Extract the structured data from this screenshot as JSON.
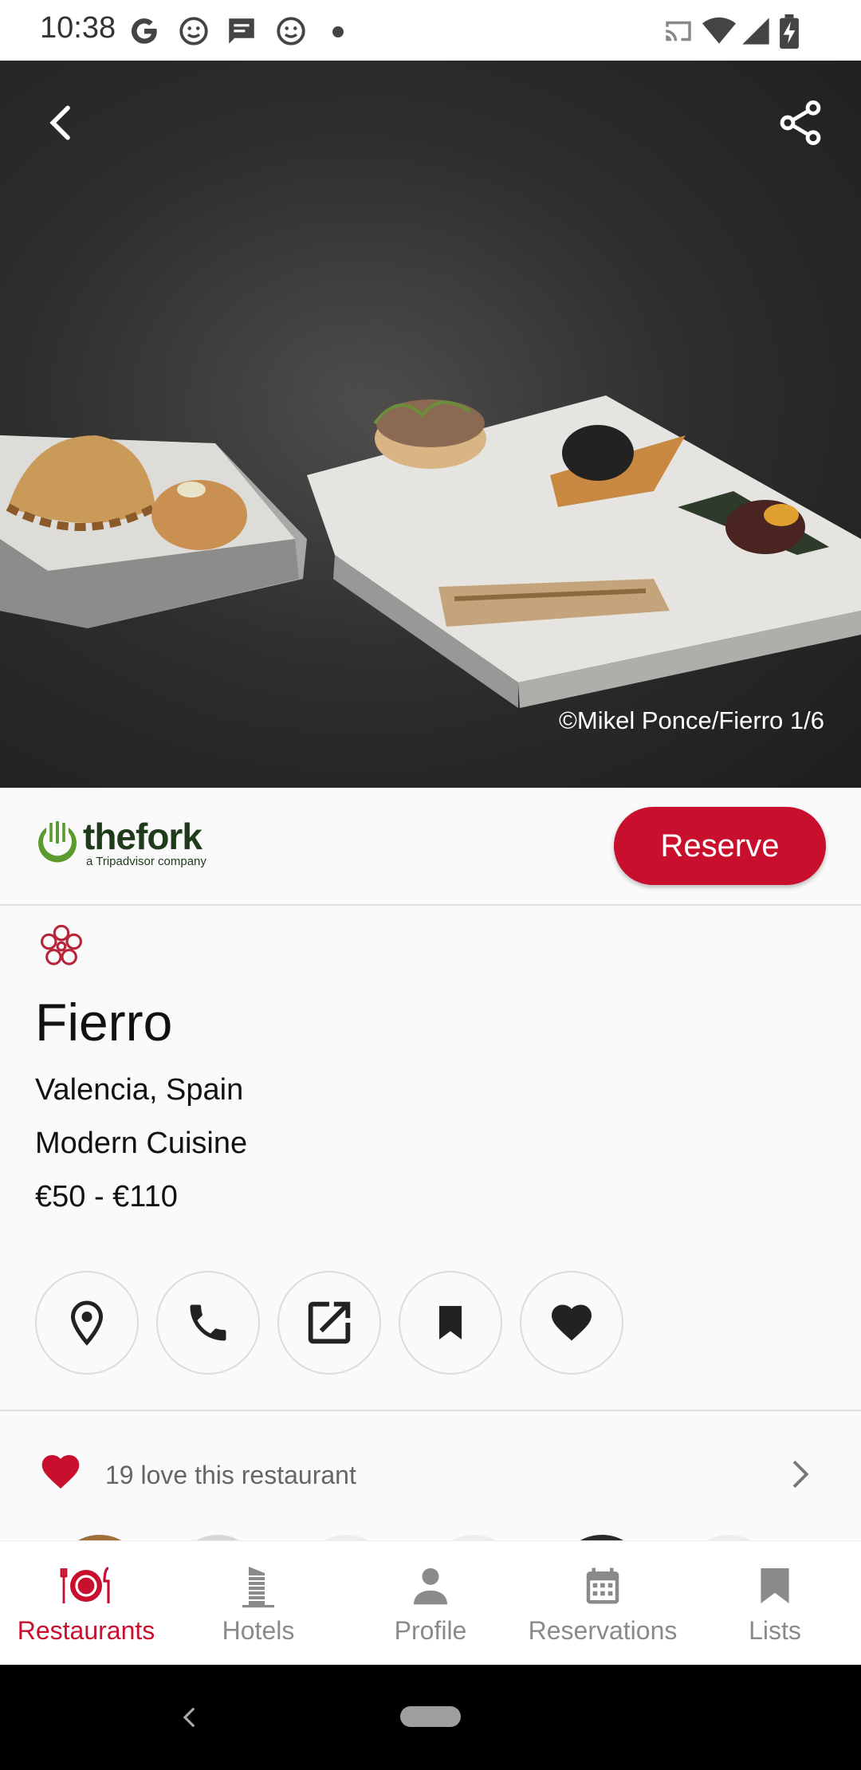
{
  "status_bar": {
    "time": "10:38",
    "notification_icons": [
      "google-icon",
      "assistant-icon",
      "message-icon",
      "assistant-icon",
      "dot-icon"
    ],
    "system_icons": [
      "cast-icon",
      "wifi-icon",
      "cell-signal-icon",
      "battery-charging-icon"
    ]
  },
  "hero": {
    "photo_credit": "©Mikel Ponce/Fierro 1/6"
  },
  "booking_bar": {
    "logo_name": "thefork",
    "logo_tagline": "a Tripadvisor company",
    "reserve_label": "Reserve"
  },
  "restaurant": {
    "name": "Fierro",
    "location": "Valencia, Spain",
    "cuisine": "Modern Cuisine",
    "price_range": "€50 - €110",
    "award_icon": "michelin-star-icon"
  },
  "action_buttons": [
    "location-icon",
    "phone-icon",
    "open-external-icon",
    "bookmark-icon",
    "heart-icon"
  ],
  "love_row": {
    "text": "19 love this restaurant"
  },
  "bottom_nav": {
    "items": [
      {
        "label": "Restaurants",
        "icon": "restaurant-icon",
        "active": true
      },
      {
        "label": "Hotels",
        "icon": "hotel-icon",
        "active": false
      },
      {
        "label": "Profile",
        "icon": "person-icon",
        "active": false
      },
      {
        "label": "Reservations",
        "icon": "calendar-icon",
        "active": false
      },
      {
        "label": "Lists",
        "icon": "bookmark-icon",
        "active": false
      }
    ]
  },
  "colors": {
    "accent": "#c8102e",
    "fork_green": "#5b9a2c",
    "inactive": "#8a8a8a"
  }
}
